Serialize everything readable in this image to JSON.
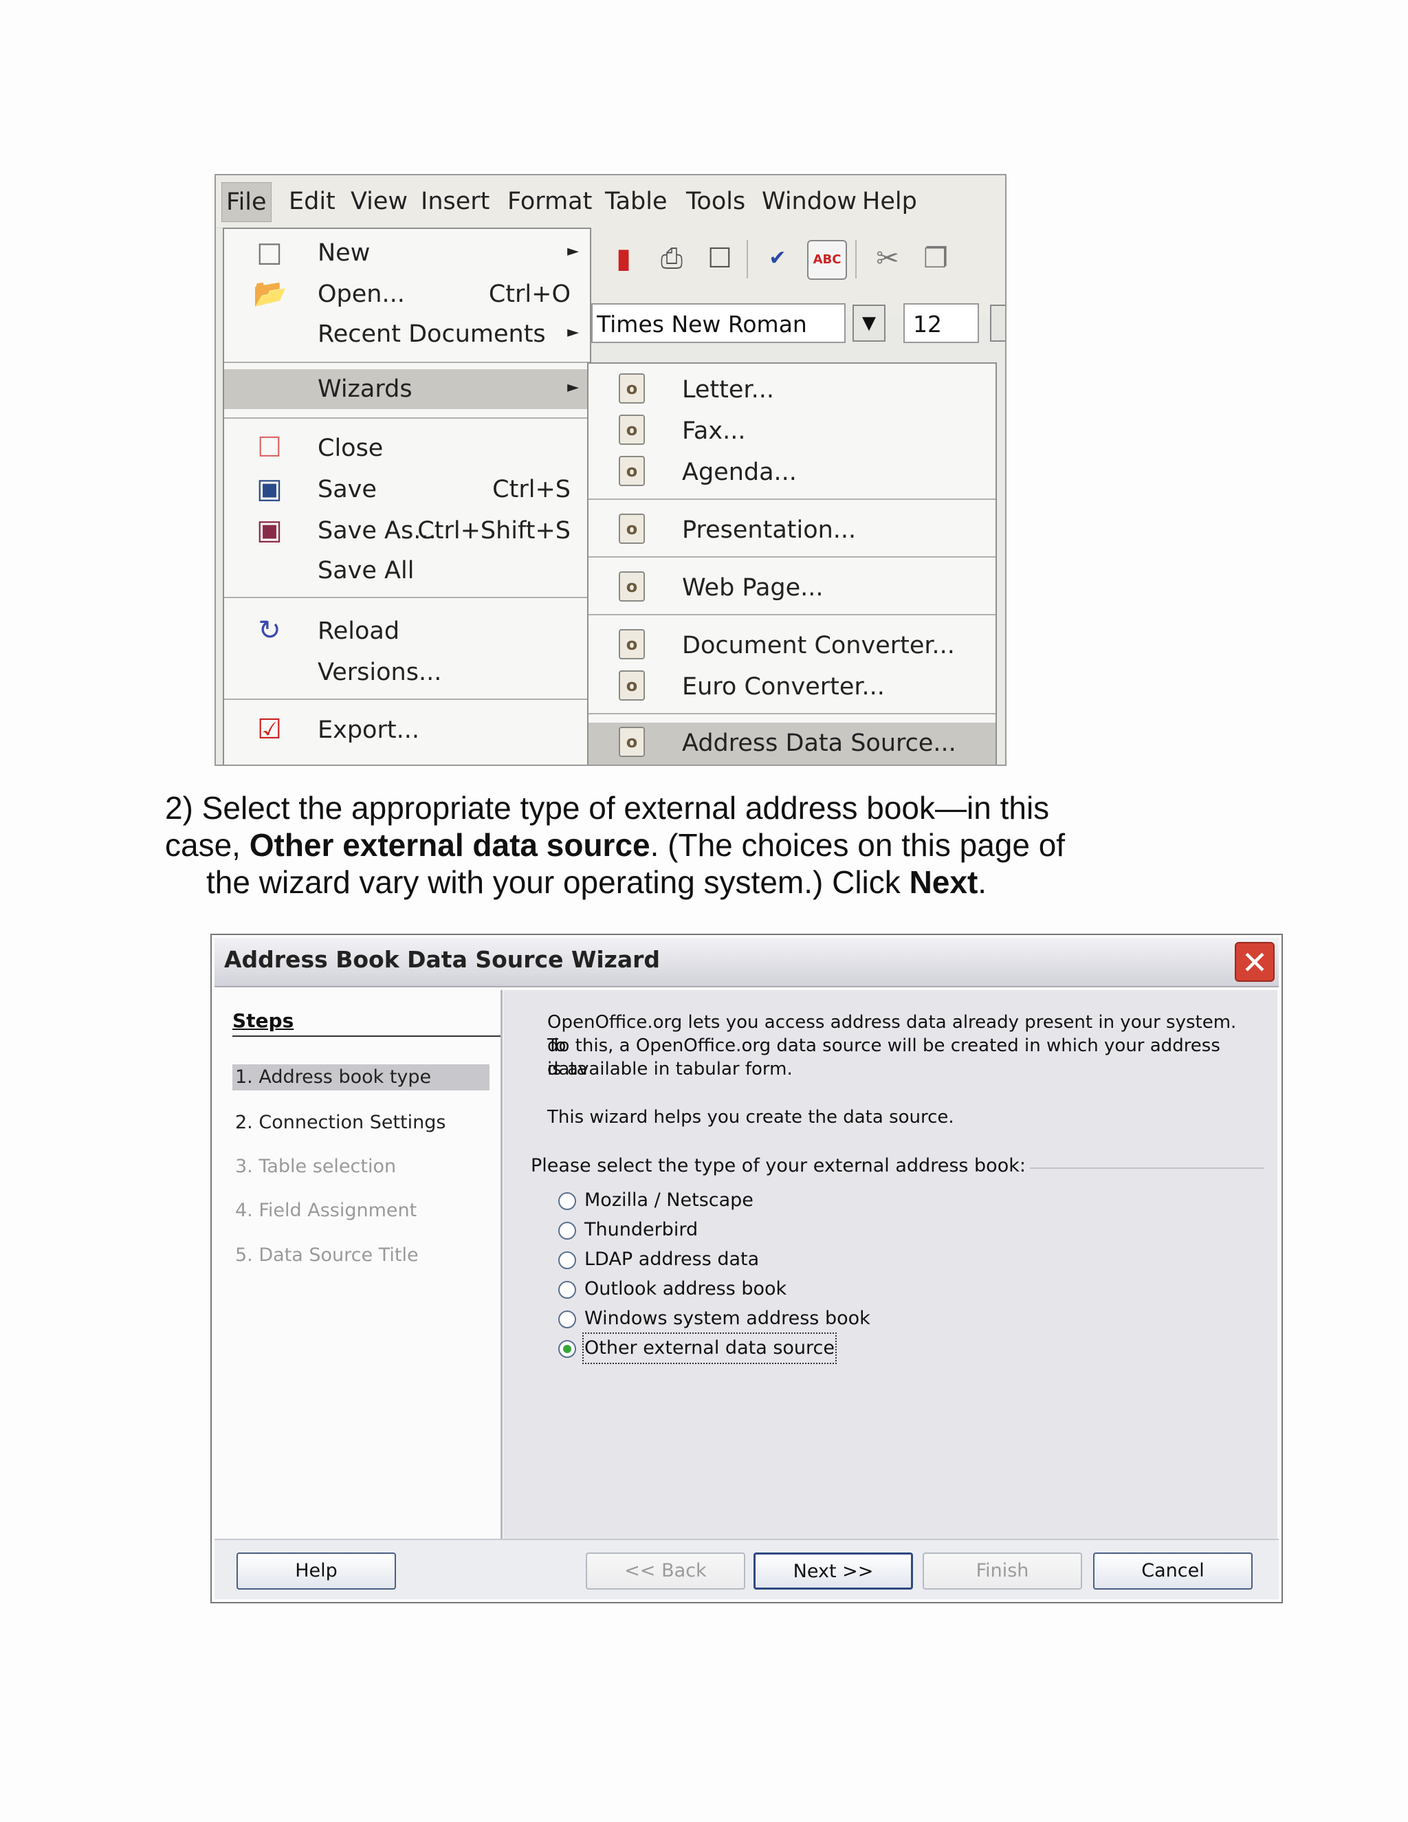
{
  "menubar": [
    "File",
    "Edit",
    "View",
    "Insert",
    "Format",
    "Table",
    "Tools",
    "Window",
    "Help"
  ],
  "toolbar": {
    "font_name": "Times New Roman",
    "font_size": "12",
    "icons": [
      "pdf-export-icon",
      "print-icon",
      "page-preview-icon",
      "spellcheck-icon",
      "autospellcheck-icon",
      "cut-icon",
      "copy-icon"
    ]
  },
  "file_menu": [
    {
      "label": "New",
      "accel": "",
      "submenu": true,
      "icon": "new-document-icon"
    },
    {
      "label": "Open...",
      "accel": "Ctrl+O",
      "submenu": false,
      "icon": "open-folder-icon"
    },
    {
      "label": "Recent Documents",
      "accel": "",
      "submenu": true,
      "icon": ""
    },
    {
      "label": "Wizards",
      "accel": "",
      "submenu": true,
      "icon": ""
    },
    {
      "label": "Close",
      "accel": "",
      "submenu": false,
      "icon": "close-document-icon"
    },
    {
      "label": "Save",
      "accel": "Ctrl+S",
      "submenu": false,
      "icon": "save-icon"
    },
    {
      "label": "Save As...",
      "accel": "Ctrl+Shift+S",
      "submenu": false,
      "icon": "save-as-icon"
    },
    {
      "label": "Save All",
      "accel": "",
      "submenu": false,
      "icon": ""
    },
    {
      "label": "Reload",
      "accel": "",
      "submenu": false,
      "icon": "reload-icon"
    },
    {
      "label": "Versions...",
      "accel": "",
      "submenu": false,
      "icon": ""
    },
    {
      "label": "Export...",
      "accel": "",
      "submenu": false,
      "icon": "export-icon"
    }
  ],
  "wizards_menu": [
    "Letter...",
    "Fax...",
    "Agenda...",
    "Presentation...",
    "Web Page...",
    "Document Converter...",
    "Euro Converter...",
    "Address Data Source..."
  ],
  "instruction": {
    "line1": "2) Select the appropriate type of external address book—in this",
    "line2_pre": "case, ",
    "line2_bold": "Other external data source",
    "line2_post": ". (The choices on this page of",
    "line3_pre": "the wizard vary with your operating system.) Click ",
    "line3_bold": "Next",
    "line3_post": "."
  },
  "dialog": {
    "title": "Address Book Data Source Wizard",
    "steps_title": "Steps",
    "steps": [
      {
        "label": "1. Address book type",
        "state": "active"
      },
      {
        "label": "2. Connection Settings",
        "state": "enabled"
      },
      {
        "label": "3. Table selection",
        "state": "disabled"
      },
      {
        "label": "4. Field Assignment",
        "state": "disabled"
      },
      {
        "label": "5. Data Source Title",
        "state": "disabled"
      }
    ],
    "intro_line1": "OpenOffice.org lets you access address data already present in your system. To",
    "intro_line2": "do this, a OpenOffice.org data source will be created in which your address data",
    "intro_line3": "is available in tabular form.",
    "intro_line4": "This wizard helps you create the data source.",
    "group_caption": "Please select the type of your external address book:",
    "options": [
      {
        "label": "Mozilla / Netscape",
        "checked": false
      },
      {
        "label": "Thunderbird",
        "checked": false
      },
      {
        "label": "LDAP address data",
        "checked": false
      },
      {
        "label": "Outlook address book",
        "checked": false
      },
      {
        "label": "Windows system address book",
        "checked": false
      },
      {
        "label": "Other external data source",
        "checked": true
      }
    ],
    "buttons": {
      "help": "Help",
      "back": "<< Back",
      "next": "Next >>",
      "finish": "Finish",
      "cancel": "Cancel"
    }
  }
}
